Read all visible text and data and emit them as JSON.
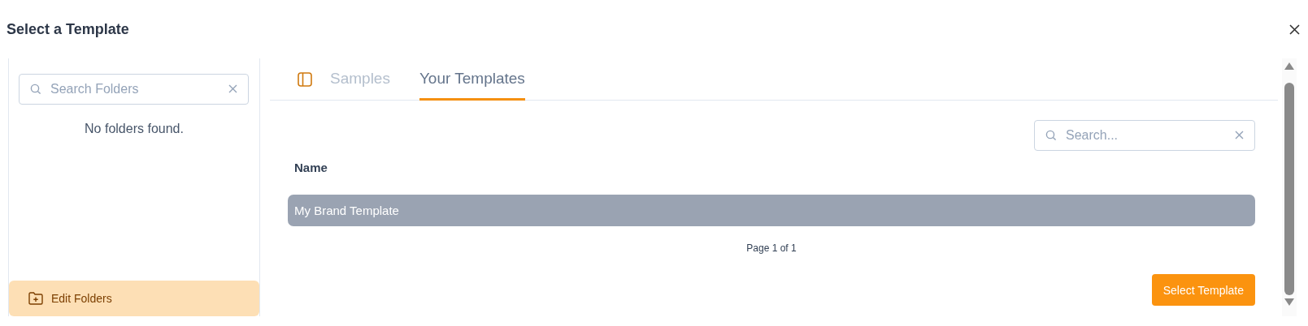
{
  "window": {
    "title": "Select a Template"
  },
  "sidebar": {
    "search": {
      "placeholder": "Search Folders"
    },
    "empty_message": "No folders found.",
    "footer_button": "Edit Folders"
  },
  "tabs": [
    {
      "label": "Samples",
      "selected": false
    },
    {
      "label": "Your Templates",
      "selected": true
    }
  ],
  "search": {
    "placeholder": "Search..."
  },
  "table": {
    "columns": [
      "Name"
    ],
    "rows": [
      {
        "name": "My Brand Template",
        "selected": true
      }
    ]
  },
  "pagination": "Page 1 of 1",
  "buttons": [
    "Select Template"
  ]
}
